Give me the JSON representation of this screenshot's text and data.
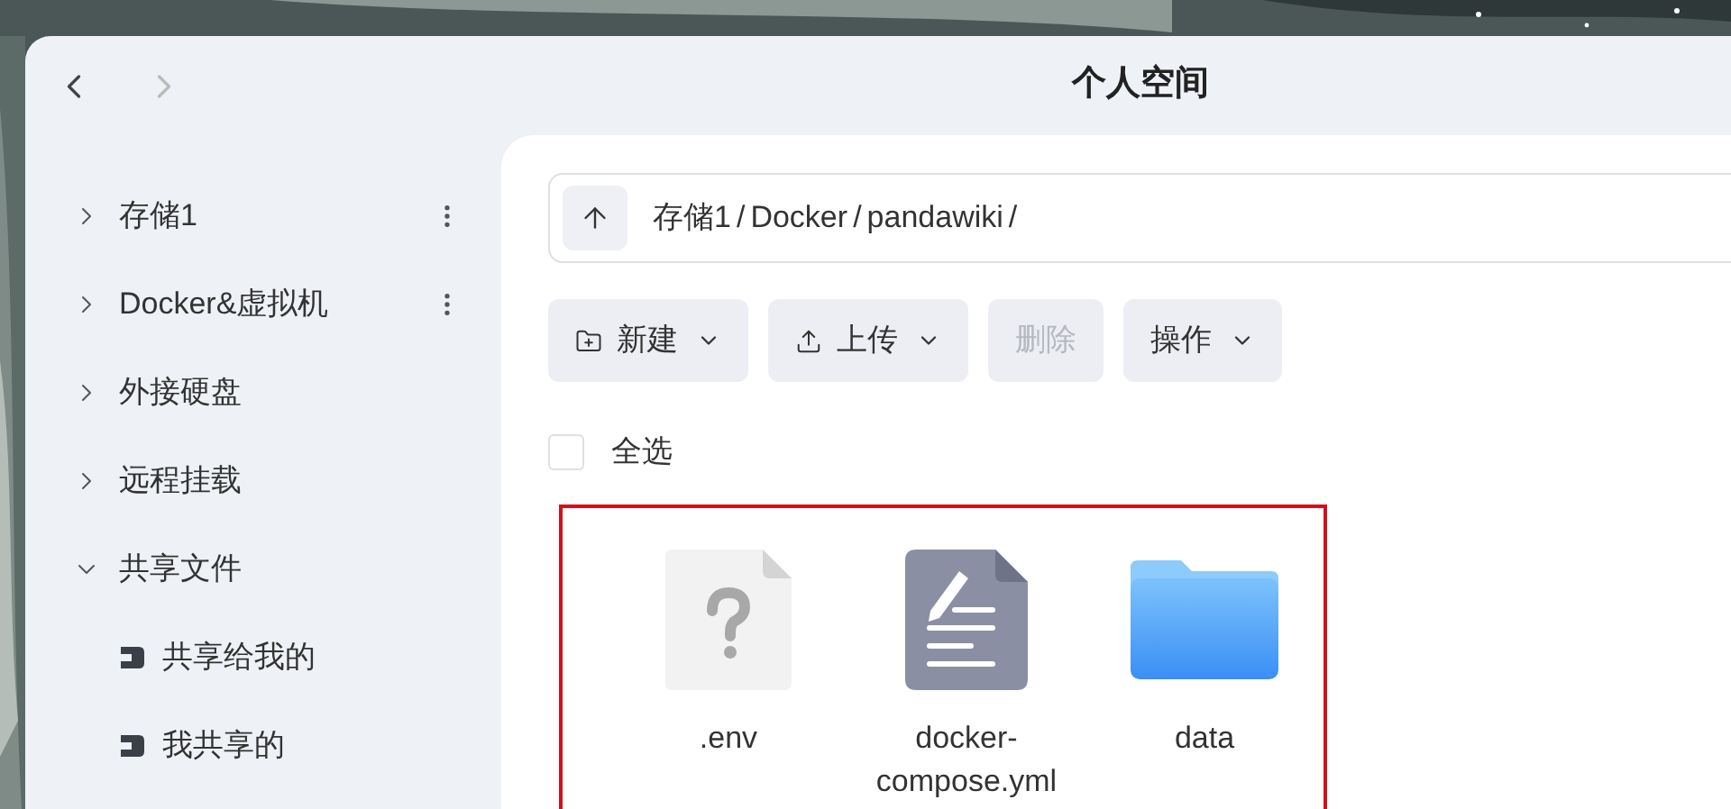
{
  "window": {
    "title": "个人空间"
  },
  "sidebar": {
    "items": [
      {
        "label": "存储1",
        "expanded": false,
        "menu": true
      },
      {
        "label": "Docker&虚拟机",
        "expanded": false,
        "menu": true
      },
      {
        "label": "外接硬盘",
        "expanded": false,
        "menu": false
      },
      {
        "label": "远程挂载",
        "expanded": false,
        "menu": false
      },
      {
        "label": "共享文件",
        "expanded": true,
        "menu": false,
        "children": [
          {
            "label": "共享给我的"
          },
          {
            "label": "我共享的"
          }
        ]
      }
    ]
  },
  "path": {
    "segments": [
      "存储1",
      "/",
      "Docker",
      "/",
      "pandawiki",
      "/"
    ]
  },
  "toolbar": [
    {
      "label": "新建",
      "kind": "new",
      "dropdown": true,
      "disabled": false
    },
    {
      "label": "上传",
      "kind": "upload",
      "dropdown": true,
      "disabled": false
    },
    {
      "label": "删除",
      "kind": "plain",
      "dropdown": false,
      "disabled": true
    },
    {
      "label": "操作",
      "kind": "plain",
      "dropdown": true,
      "disabled": false
    }
  ],
  "select_all": {
    "label": "全选",
    "checked": false
  },
  "files": [
    {
      "name": ".env",
      "kind": "unknown"
    },
    {
      "name": "docker-\ncompose.yml",
      "kind": "document"
    },
    {
      "name": "data",
      "kind": "folder"
    }
  ]
}
